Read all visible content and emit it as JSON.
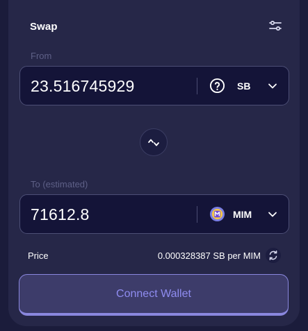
{
  "header": {
    "title": "Swap",
    "settings_icon": "sliders-icon"
  },
  "from": {
    "label": "From",
    "amount": "23.516745929",
    "token_symbol": "SB",
    "token_icon": "question-circle-icon"
  },
  "switch": {
    "icon": "swap-up-down-chevrons-icon"
  },
  "to": {
    "label": "To (estimated)",
    "amount": "71612.8",
    "token_symbol": "MIM",
    "token_icon": "mim-token-logo"
  },
  "price": {
    "label": "Price",
    "value": "0.000328387 SB per MIM",
    "flip_icon": "refresh-arrows-icon"
  },
  "connect": {
    "label": "Connect Wallet"
  },
  "colors": {
    "page_bg": "#1b1c3b",
    "card_bg": "#262748",
    "field_bg": "#141438",
    "field_border": "#4d4f76",
    "muted_text": "#5e6087",
    "accent": "#8f8cf0",
    "button_bg": "#3d3c6a"
  }
}
